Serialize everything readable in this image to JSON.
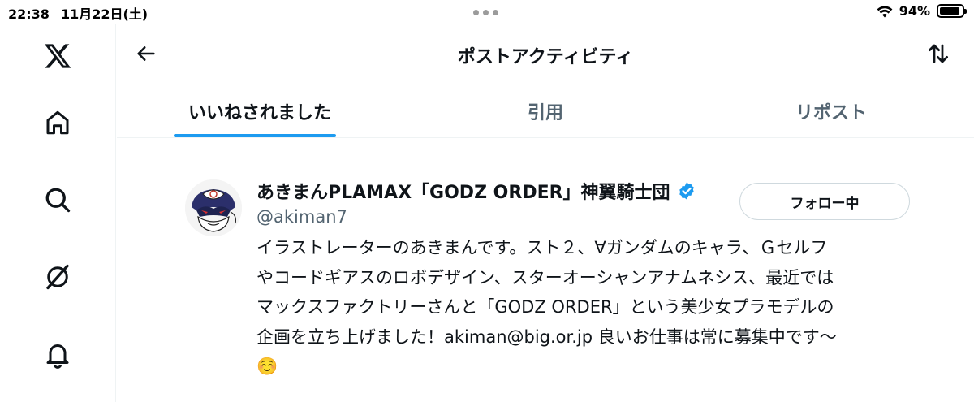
{
  "status_bar": {
    "time": "22:38",
    "date": "11月22日(土)",
    "battery_percent": "94%",
    "battery_level": 0.94
  },
  "nav": {
    "items": [
      "x-logo-icon",
      "home-icon",
      "search-icon",
      "grok-icon",
      "notifications-icon"
    ]
  },
  "header": {
    "title": "ポストアクティビティ"
  },
  "tabs": [
    {
      "label": "いいねされました",
      "active": true
    },
    {
      "label": "引用",
      "active": false
    },
    {
      "label": "リポスト",
      "active": false
    }
  ],
  "user": {
    "name": "あきまんPLAMAX「GODZ ORDER」神翼騎士団",
    "handle": "@akiman7",
    "verified": true,
    "follow_label": "フォロー中",
    "bio_lines": [
      "イラストレーターのあきまんです。スト２、∀ガンダムのキャラ、Ｇセルフ",
      "やコードギアスのロボデザイン、スターオーシャンアナムネシス、最近では",
      "マックスファクトリーさんと「GODZ ORDER」という美少女プラモデルの",
      "企画を立ち上げました！akiman@big.or.jp 良いお仕事は常に募集中です〜",
      "☺️"
    ]
  },
  "colors": {
    "accent": "#1d9bf0",
    "text_primary": "#0f1419",
    "text_secondary": "#536471"
  }
}
